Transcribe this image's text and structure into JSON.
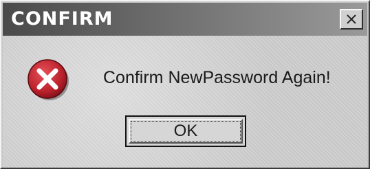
{
  "dialog": {
    "title": "CONFIRM",
    "message": "Confirm NewPassword Again!",
    "ok_label": "OK",
    "icon": "error-x-icon",
    "close_icon": "close-icon"
  },
  "colors": {
    "title_text": "#ffffff",
    "icon_red": "#b8202a",
    "face": "#c8c8c8"
  }
}
